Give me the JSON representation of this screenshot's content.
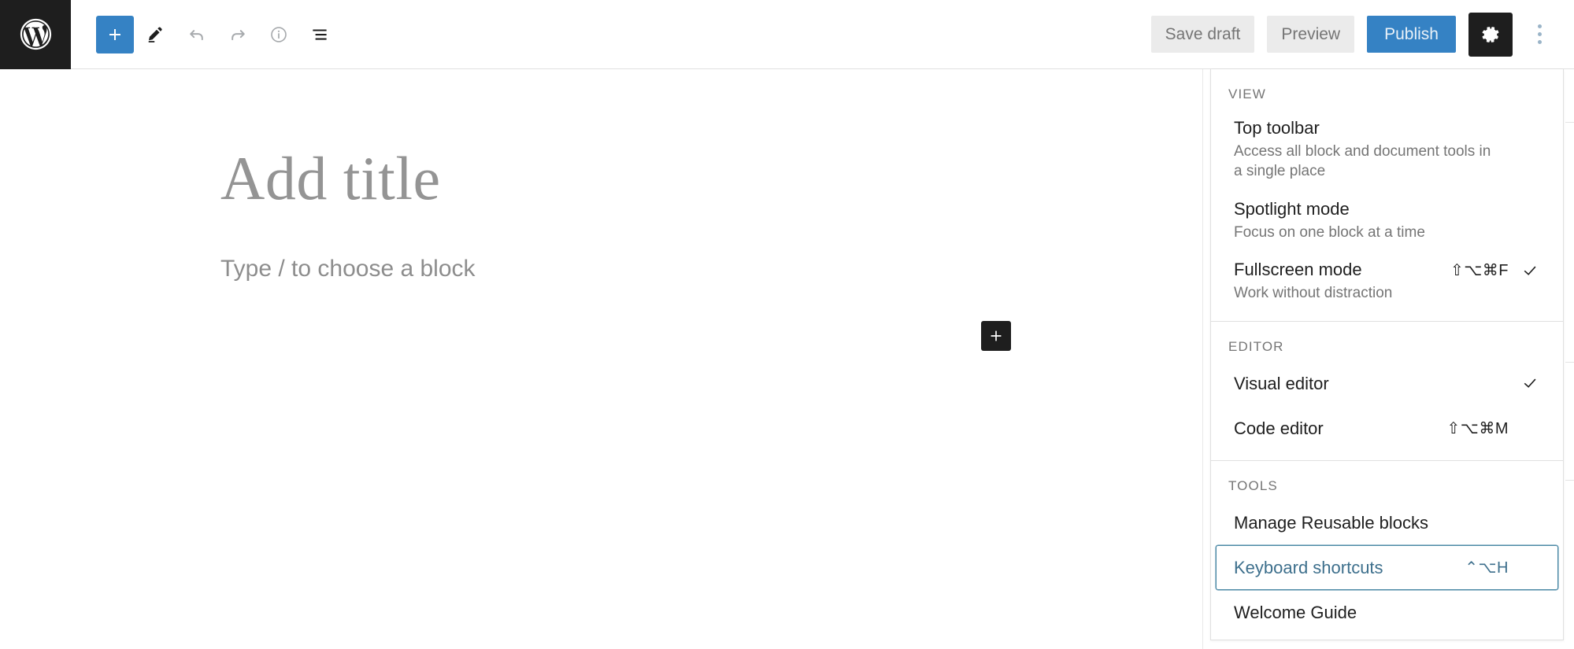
{
  "app": {
    "name": "WordPress Block Editor",
    "logo_icon": "wordpress-logo-icon"
  },
  "toolbar": {
    "left_tools": [
      {
        "name": "block-inserter-toggle",
        "icon": "plus-icon",
        "label": "Add block",
        "state": "active"
      },
      {
        "name": "tools-edit",
        "icon": "pencil-icon",
        "label": "Tools",
        "state": "default"
      },
      {
        "name": "undo",
        "icon": "undo-arrow-icon",
        "label": "Undo",
        "state": "disabled"
      },
      {
        "name": "redo",
        "icon": "redo-arrow-icon",
        "label": "Redo",
        "state": "disabled"
      },
      {
        "name": "details",
        "icon": "info-circle-icon",
        "label": "Details",
        "state": "disabled"
      },
      {
        "name": "list-view",
        "icon": "list-view-icon",
        "label": "List view",
        "state": "default"
      }
    ],
    "save_draft_label": "Save draft",
    "preview_label": "Preview",
    "publish_label": "Publish",
    "settings_icon": "gear-icon",
    "settings_label": "Settings",
    "more_menu_icon": "vertical-ellipsis-icon",
    "more_menu_label": "Options"
  },
  "editor": {
    "title_placeholder": "Add title",
    "block_placeholder": "Type / to choose a block",
    "inline_inserter_icon": "plus-icon",
    "inline_inserter_label": "Add block"
  },
  "dropdown": {
    "groups": [
      {
        "label": "VIEW",
        "items": [
          {
            "title": "Top toolbar",
            "description": "Access all block and document tools in a single place",
            "shortcut": "",
            "checked": false,
            "focused": false,
            "compact": false
          },
          {
            "title": "Spotlight mode",
            "description": "Focus on one block at a time",
            "shortcut": "",
            "checked": false,
            "focused": false,
            "compact": false
          },
          {
            "title": "Fullscreen mode",
            "description": "Work without distraction",
            "shortcut": "⇧⌥⌘F",
            "checked": true,
            "focused": false,
            "compact": false
          }
        ]
      },
      {
        "label": "EDITOR",
        "items": [
          {
            "title": "Visual editor",
            "description": "",
            "shortcut": "",
            "checked": true,
            "focused": false,
            "compact": true
          },
          {
            "title": "Code editor",
            "description": "",
            "shortcut": "⇧⌥⌘M",
            "checked": false,
            "focused": false,
            "compact": true
          }
        ]
      },
      {
        "label": "TOOLS",
        "items": [
          {
            "title": "Manage Reusable blocks",
            "description": "",
            "shortcut": "",
            "checked": false,
            "focused": false,
            "compact": true
          },
          {
            "title": "Keyboard shortcuts",
            "description": "",
            "shortcut": "⌃⌥H",
            "checked": false,
            "focused": true,
            "compact": true
          },
          {
            "title": "Welcome Guide",
            "description": "",
            "shortcut": "",
            "checked": false,
            "focused": false,
            "compact": true
          }
        ]
      }
    ]
  },
  "colors": {
    "accent_blue": "#3582c4",
    "dark": "#1e1e1e",
    "muted_text": "#757575",
    "focus_blue": "#4a88a5",
    "focus_text": "#3d6f8c",
    "button_bg": "#ebebeb"
  }
}
